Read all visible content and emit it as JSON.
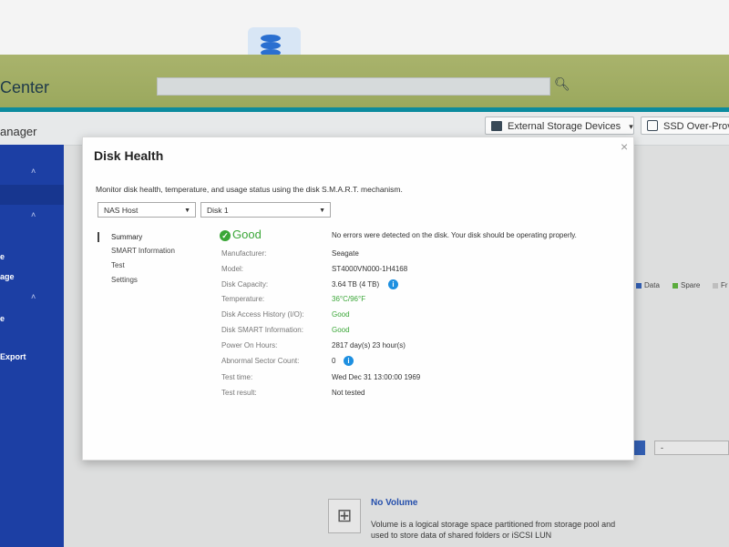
{
  "app": {
    "brand": "Center",
    "page_title": "anager"
  },
  "toolbar": {
    "external_storage_label": "External Storage Devices",
    "external_storage_chevron": "▾",
    "ssd_label": "SSD Over-Provi"
  },
  "sidebar": {
    "labels": [
      "e",
      "age",
      "e",
      "Export"
    ]
  },
  "background": {
    "legend": [
      {
        "label": "Data",
        "color": "#2d5fbd"
      },
      {
        "label": "Spare",
        "color": "#5cb83a"
      },
      {
        "label": "Fr",
        "color": "#cccccc"
      }
    ],
    "no_volume_title": "No Volume",
    "no_volume_desc": "Volume is a logical storage space partitioned from storage pool and used to store data of shared folders or iSCSI LUN",
    "mini_select": "-"
  },
  "dialog": {
    "title": "Disk Health",
    "close": "×",
    "description": "Monitor disk health, temperature, and usage status using the disk S.M.A.R.T. mechanism.",
    "host_select": "NAS Host",
    "disk_select": "Disk 1",
    "nav": [
      "Summary",
      "SMART Information",
      "Test",
      "Settings"
    ],
    "status": "Good",
    "status_message": "No errors were detected on the disk. Your disk should be operating properly.",
    "rows": [
      {
        "label": "Manufacturer:",
        "value": "Seagate"
      },
      {
        "label": "Model:",
        "value": "ST4000VN000-1H4168"
      },
      {
        "label": "Disk Capacity:",
        "value": "3.64 TB (4 TB)"
      },
      {
        "label": "Temperature:",
        "value": "36°C/96°F"
      },
      {
        "label": "Disk Access History (I/O):",
        "value": "Good"
      },
      {
        "label": "Disk SMART Information:",
        "value": "Good"
      },
      {
        "label": "Power On Hours:",
        "value": "2817 day(s) 23 hour(s)"
      },
      {
        "label": "Abnormal Sector Count:",
        "value": "0"
      },
      {
        "label": "Test time:",
        "value": "Wed Dec 31 13:00:00 1969"
      },
      {
        "label": "Test result:",
        "value": "Not tested"
      }
    ],
    "info_glyph": "i",
    "check_glyph": "✓"
  },
  "colors": {
    "accent_green": "#3aa637",
    "info_blue": "#1d8fe0",
    "sidebar_blue": "#1c3fa4"
  }
}
